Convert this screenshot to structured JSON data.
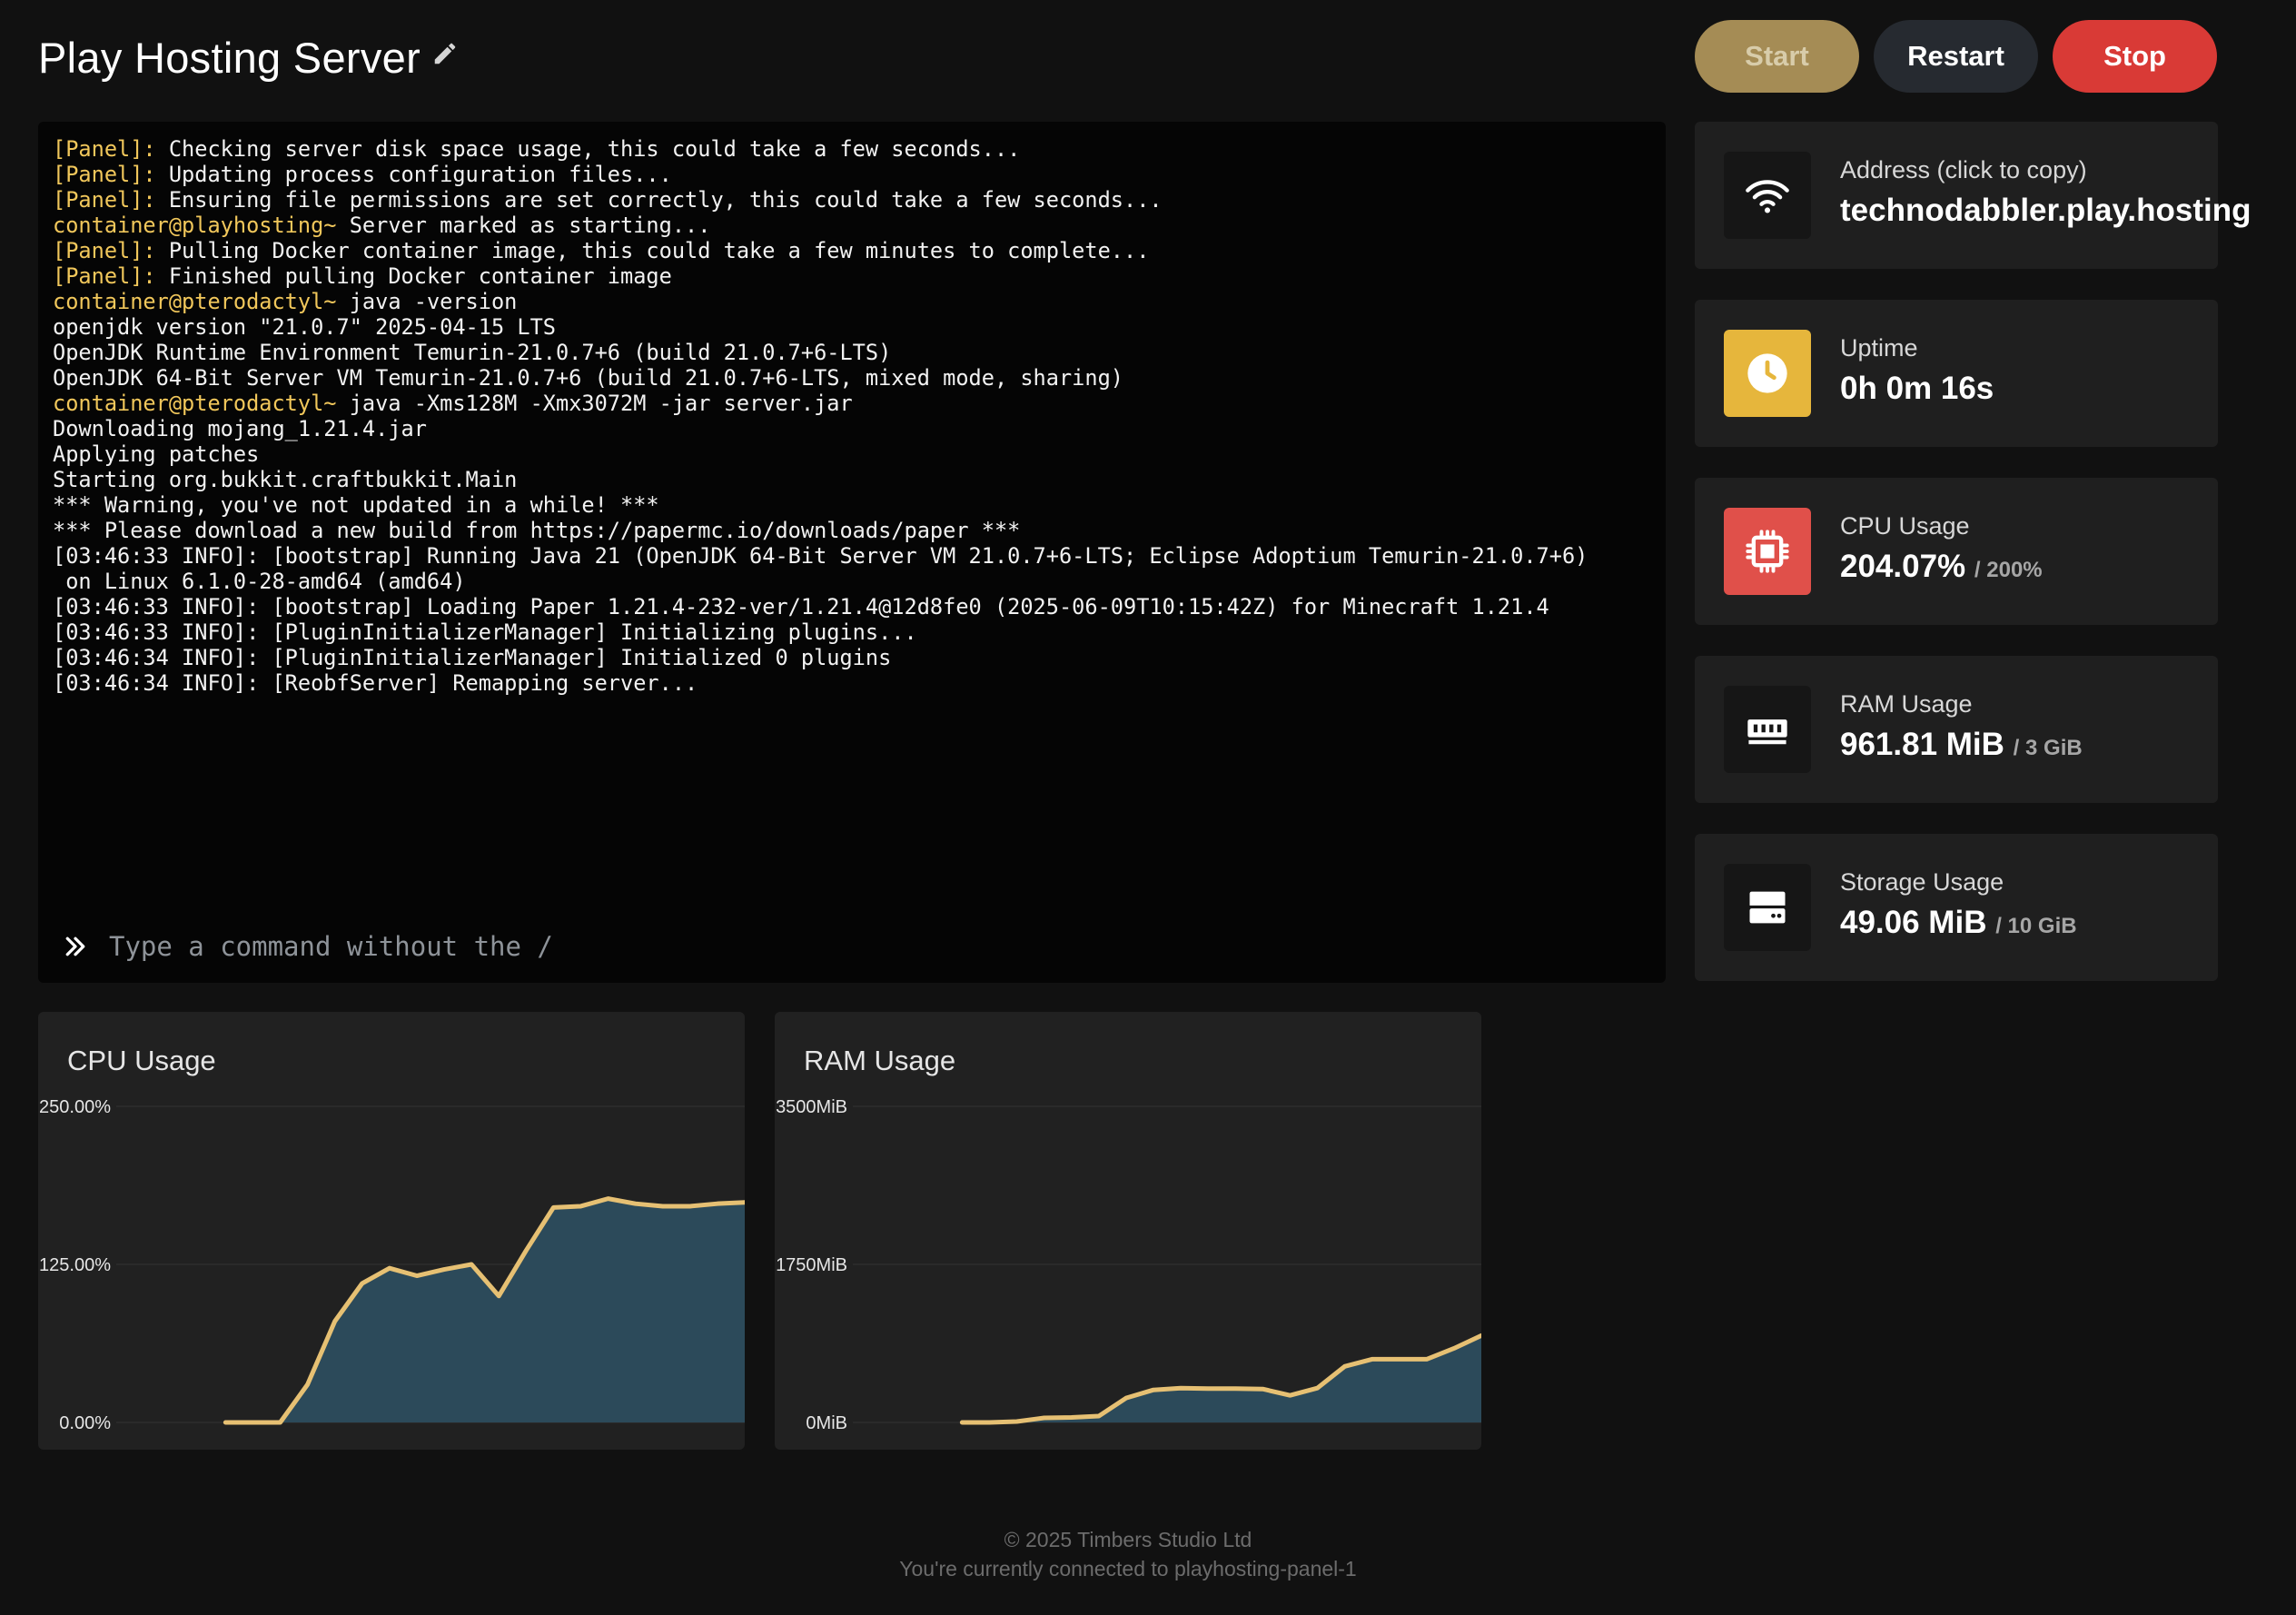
{
  "header": {
    "title": "Play Hosting Server",
    "start_label": "Start",
    "restart_label": "Restart",
    "stop_label": "Stop"
  },
  "console": {
    "lines": [
      {
        "prefix": "[Panel]:",
        "text": " Checking server disk space usage, this could take a few seconds..."
      },
      {
        "prefix": "[Panel]:",
        "text": " Updating process configuration files..."
      },
      {
        "prefix": "[Panel]:",
        "text": " Ensuring file permissions are set correctly, this could take a few seconds..."
      },
      {
        "prefix": "container@playhosting~",
        "text": " Server marked as starting..."
      },
      {
        "prefix": "[Panel]:",
        "text": " Pulling Docker container image, this could take a few minutes to complete..."
      },
      {
        "prefix": "[Panel]:",
        "text": " Finished pulling Docker container image"
      },
      {
        "prefix": "container@pterodactyl~",
        "text": " java -version"
      },
      {
        "prefix": "",
        "text": "openjdk version \"21.0.7\" 2025-04-15 LTS"
      },
      {
        "prefix": "",
        "text": "OpenJDK Runtime Environment Temurin-21.0.7+6 (build 21.0.7+6-LTS)"
      },
      {
        "prefix": "",
        "text": "OpenJDK 64-Bit Server VM Temurin-21.0.7+6 (build 21.0.7+6-LTS, mixed mode, sharing)"
      },
      {
        "prefix": "container@pterodactyl~",
        "text": " java -Xms128M -Xmx3072M -jar server.jar"
      },
      {
        "prefix": "",
        "text": "Downloading mojang_1.21.4.jar"
      },
      {
        "prefix": "",
        "text": "Applying patches"
      },
      {
        "prefix": "",
        "text": "Starting org.bukkit.craftbukkit.Main"
      },
      {
        "prefix": "",
        "text": "*** Warning, you've not updated in a while! ***"
      },
      {
        "prefix": "",
        "text": "*** Please download a new build from https://papermc.io/downloads/paper ***"
      },
      {
        "prefix": "",
        "text": "[03:46:33 INFO]: [bootstrap] Running Java 21 (OpenJDK 64-Bit Server VM 21.0.7+6-LTS; Eclipse Adoptium Temurin-21.0.7+6)"
      },
      {
        "prefix": "",
        "text": " on Linux 6.1.0-28-amd64 (amd64)"
      },
      {
        "prefix": "",
        "text": "[03:46:33 INFO]: [bootstrap] Loading Paper 1.21.4-232-ver/1.21.4@12d8fe0 (2025-06-09T10:15:42Z) for Minecraft 1.21.4"
      },
      {
        "prefix": "",
        "text": "[03:46:33 INFO]: [PluginInitializerManager] Initializing plugins..."
      },
      {
        "prefix": "",
        "text": "[03:46:34 INFO]: [PluginInitializerManager] Initialized 0 plugins"
      },
      {
        "prefix": "",
        "text": "[03:46:34 INFO]: [ReobfServer] Remapping server..."
      }
    ],
    "input_placeholder": "Type a command without the /",
    "input_value": ""
  },
  "stats": {
    "address": {
      "label": "Address (click to copy)",
      "value": "technodabbler.play.hosting",
      "icon": "wifi-icon"
    },
    "uptime": {
      "label": "Uptime",
      "value": "0h 0m 16s",
      "icon": "clock-icon"
    },
    "cpu": {
      "label": "CPU Usage",
      "value": "204.07%",
      "limit": "/ 200%",
      "icon": "cpu-chip-icon"
    },
    "ram": {
      "label": "RAM Usage",
      "value": "961.81 MiB",
      "limit": "/ 3 GiB",
      "icon": "memory-icon"
    },
    "storage": {
      "label": "Storage Usage",
      "value": "49.06 MiB",
      "limit": "/ 10 GiB",
      "icon": "hard-drive-icon"
    }
  },
  "colors": {
    "accent": "#e6c073",
    "area_fill": "#2c4a5a",
    "danger": "#d93a36",
    "start": "#a58c55",
    "console_prefix": "#f1c75b"
  },
  "chart_data": [
    {
      "type": "area",
      "title": "CPU Usage",
      "y_tick_labels": [
        "250.00%",
        "125.00%",
        "0.00%"
      ],
      "ylim": [
        0,
        250
      ],
      "unit": "%",
      "values": [
        null,
        null,
        null,
        null,
        0,
        0,
        0,
        30,
        80,
        110,
        122,
        116,
        121,
        125,
        100,
        136,
        170,
        171,
        177,
        173,
        171,
        171,
        173,
        174
      ]
    },
    {
      "type": "area",
      "title": "RAM Usage",
      "y_tick_labels": [
        "3500MiB",
        "1750MiB",
        "0MiB"
      ],
      "ylim": [
        0,
        3500
      ],
      "unit": "MiB",
      "values": [
        null,
        null,
        null,
        null,
        0,
        0,
        10,
        50,
        55,
        70,
        270,
        360,
        380,
        375,
        375,
        370,
        300,
        380,
        620,
        700,
        700,
        700,
        820,
        961.81
      ]
    }
  ],
  "footer": {
    "copyright": "© 2025 Timbers Studio Ltd",
    "connection": "You're currently connected to playhosting-panel-1"
  }
}
